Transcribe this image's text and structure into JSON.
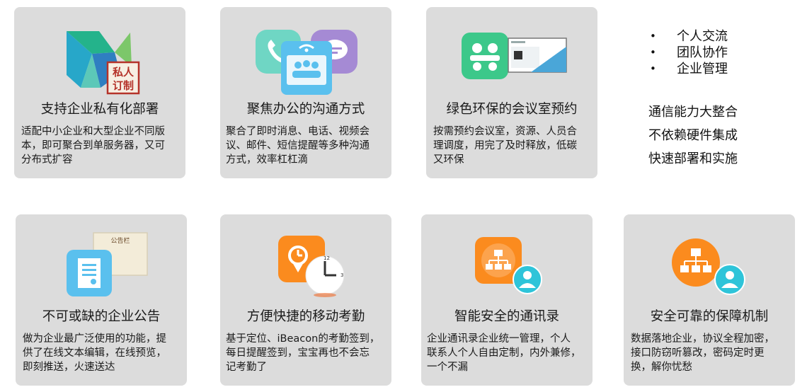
{
  "cards": [
    {
      "title": "支持企业私有化部署",
      "desc": [
        "适配中小企业和大型企业不同版",
        "本，即可聚合到单服务器，又可",
        "分布式扩容"
      ],
      "stamp": [
        "私人",
        "订制"
      ]
    },
    {
      "title": "聚焦办公的沟通方式",
      "desc": [
        "聚合了即时消息、电话、视频会",
        "议、邮件、短信提醒等多种沟通",
        "方式，效率杠杠滴"
      ]
    },
    {
      "title": "绿色环保的会议室预约",
      "desc": [
        "按需预约会议室，资源、人员合",
        "理调度，用完了及时释放，低碳",
        "又环保"
      ]
    },
    {
      "title": "不可或缺的企业公告",
      "desc": [
        "做为企业最广泛使用的功能，提",
        "供了在线文本编辑，在线预览，",
        "即刻推送，火速送达"
      ],
      "board_label": "公告栏"
    },
    {
      "title": "方便快捷的移动考勤",
      "desc": [
        "基于定位、iBeacon的考勤签到，",
        "每日提醒签到，宝宝再也不会忘",
        "记考勤了"
      ]
    },
    {
      "title": "智能安全的通讯录",
      "desc": [
        "企业通讯录企业统一管理，个人",
        "联系人个人自由定制，内外兼修，",
        "一个不漏"
      ]
    },
    {
      "title": "安全可靠的保障机制",
      "desc": [
        "数据落地企业，协议全程加密，",
        "接口防窃听篡改，密码定时更",
        "换，解你忧愁"
      ]
    }
  ],
  "side": {
    "bullets": [
      "个人交流",
      "团队协作",
      "企业管理"
    ],
    "features": [
      "通信能力大整合",
      "不依赖硬件集成",
      "快速部署和实施"
    ]
  },
  "colors": {
    "card_bg": "#dcdcdc",
    "teal": "#3ec2d0",
    "green": "#3cc88a",
    "orange": "#fb8b1e",
    "purple": "#a58ad4",
    "blue": "#5ac0ee",
    "stamp_red": "#b5332a"
  }
}
